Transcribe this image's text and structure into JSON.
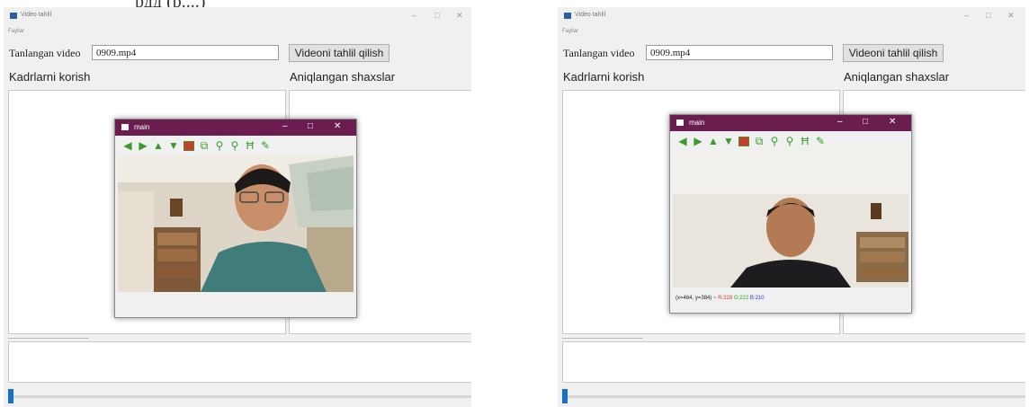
{
  "caption": "рдд (р....)",
  "windows": [
    {
      "title": "Video tahlil",
      "menu": "Fayllar",
      "controls": [
        "–",
        "□",
        "✕"
      ],
      "video_label": "Tanlangan video",
      "video_value": "0909.mp4",
      "analyze_button": "Videoni tahlil qilish",
      "frames_label": "Kadrlarni korish",
      "found_label": "Aniqlangan shaxslar",
      "slider_value": 0,
      "preview": {
        "title": "main",
        "controls": [
          "–",
          "□",
          "✕"
        ],
        "toolbar_icons": [
          "arrow-left-icon",
          "arrow-right-icon",
          "arrow-up-icon",
          "arrow-down-icon",
          "save-image-icon",
          "copy-icon",
          "zoom-in-icon",
          "zoom-out-icon",
          "properties-icon",
          "pen-icon"
        ],
        "status_coords": "",
        "status_r": "",
        "status_g": "",
        "status_b": ""
      }
    },
    {
      "title": "Video tahlil",
      "menu": "Fayllar",
      "controls": [
        "–",
        "□",
        "✕"
      ],
      "video_label": "Tanlangan video",
      "video_value": "0909.mp4",
      "analyze_button": "Videoni tahlil qilish",
      "frames_label": "Kadrlarni korish",
      "found_label": "Aniqlangan shaxslar",
      "slider_value": 0,
      "preview": {
        "title": "main",
        "controls": [
          "–",
          "□",
          "✕"
        ],
        "toolbar_icons": [
          "arrow-left-icon",
          "arrow-right-icon",
          "arrow-up-icon",
          "arrow-down-icon",
          "save-image-icon",
          "copy-icon",
          "zoom-in-icon",
          "zoom-out-icon",
          "properties-icon",
          "pen-icon"
        ],
        "status_coords": "(x=464, y=384) ~",
        "status_r": "R:228",
        "status_g": "G:222",
        "status_b": "B:210"
      }
    }
  ]
}
